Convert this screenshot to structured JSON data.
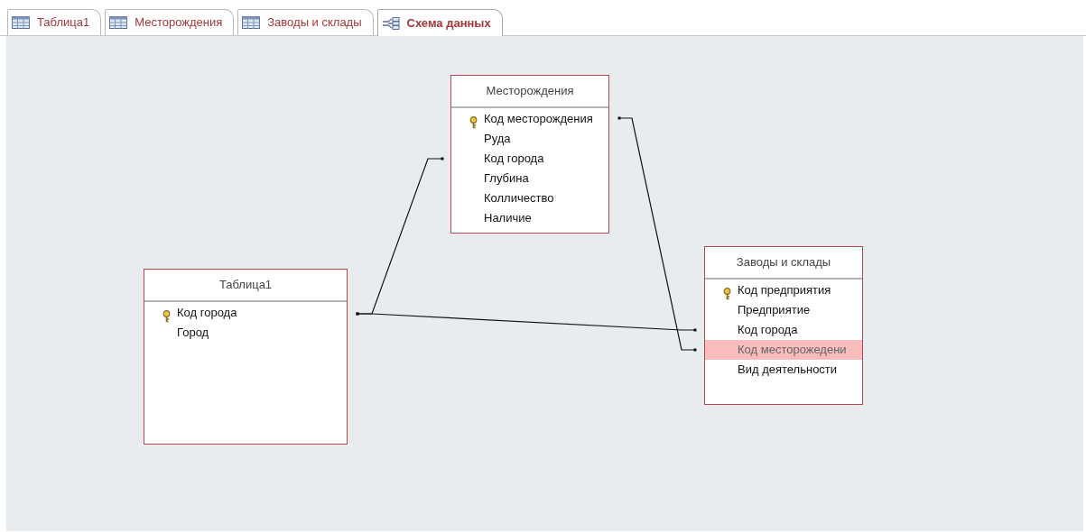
{
  "tabs": [
    {
      "label": "Таблица1",
      "kind": "table",
      "selected": false
    },
    {
      "label": "Месторождения",
      "kind": "table",
      "selected": false
    },
    {
      "label": "Заводы и склады",
      "kind": "table",
      "selected": false
    },
    {
      "label": "Схема данных",
      "kind": "schema",
      "selected": true
    }
  ],
  "tables": [
    {
      "title": "Месторождения",
      "fields": [
        {
          "name": "Код месторождения",
          "key": true,
          "selected": false
        },
        {
          "name": "Руда",
          "key": false,
          "selected": false
        },
        {
          "name": "Код города",
          "key": false,
          "selected": false
        },
        {
          "name": "Глубина",
          "key": false,
          "selected": false
        },
        {
          "name": "Колличество",
          "key": false,
          "selected": false
        },
        {
          "name": "Наличие",
          "key": false,
          "selected": false
        }
      ]
    },
    {
      "title": "Заводы и склады",
      "fields": [
        {
          "name": "Код предприятия",
          "key": true,
          "selected": false
        },
        {
          "name": "Предприятие",
          "key": false,
          "selected": false
        },
        {
          "name": "Код города",
          "key": false,
          "selected": false
        },
        {
          "name": "Код месторожедени",
          "key": false,
          "selected": true
        },
        {
          "name": "Вид деятельности",
          "key": false,
          "selected": false
        }
      ]
    },
    {
      "title": "Таблица1",
      "fields": [
        {
          "name": "Код города",
          "key": true,
          "selected": false
        },
        {
          "name": "Город",
          "key": false,
          "selected": false
        }
      ]
    }
  ]
}
